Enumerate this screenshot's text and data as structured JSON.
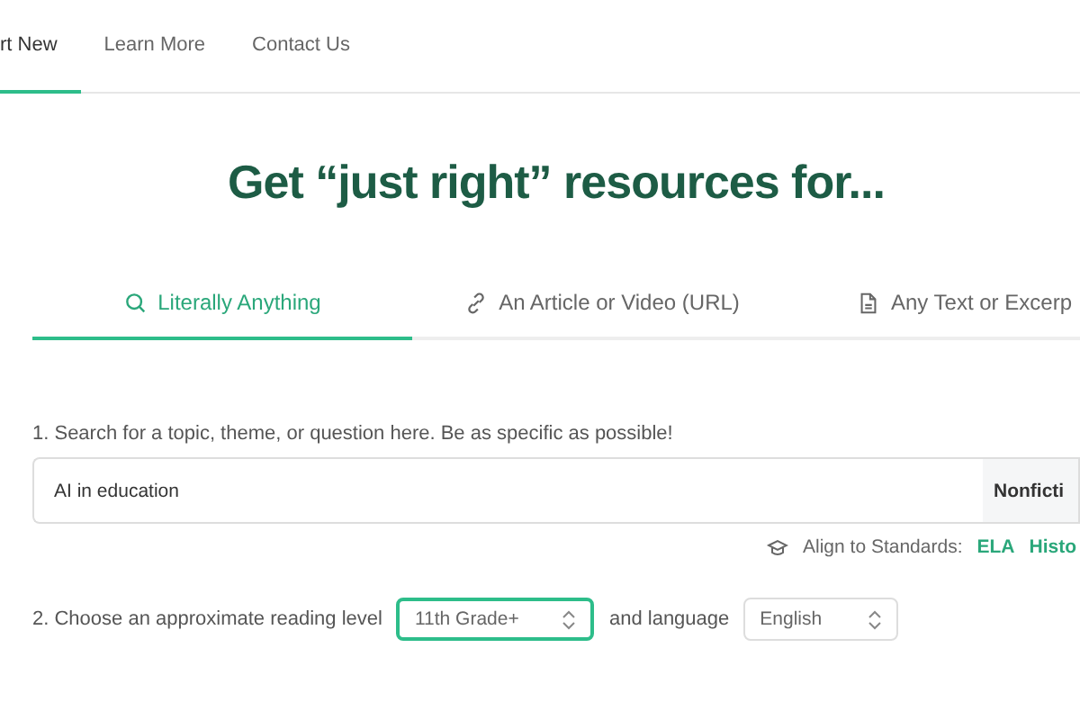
{
  "nav": {
    "items": [
      {
        "label": "rt New",
        "selected": true
      },
      {
        "label": "Learn More",
        "selected": false
      },
      {
        "label": "Contact Us",
        "selected": false
      }
    ]
  },
  "heading": "Get “just right” resources for...",
  "tabs": [
    {
      "label": "Literally Anything",
      "kind": "search",
      "selected": true
    },
    {
      "label": "An Article or Video (URL)",
      "kind": "link",
      "selected": false
    },
    {
      "label": "Any Text or Excerp",
      "kind": "document",
      "selected": false
    }
  ],
  "step1": {
    "label": "1. Search for a topic, theme, or question here. Be as specific as possible!",
    "value": "AI in education",
    "type_button": "Nonficti"
  },
  "standards": {
    "label": "Align to Standards:",
    "links": [
      "ELA",
      "Histo"
    ]
  },
  "step2": {
    "label": "2. Choose an approximate reading level",
    "level": {
      "value": "11th Grade+",
      "focused": true
    },
    "language_label": "and language",
    "language": {
      "value": "English",
      "focused": false
    }
  }
}
